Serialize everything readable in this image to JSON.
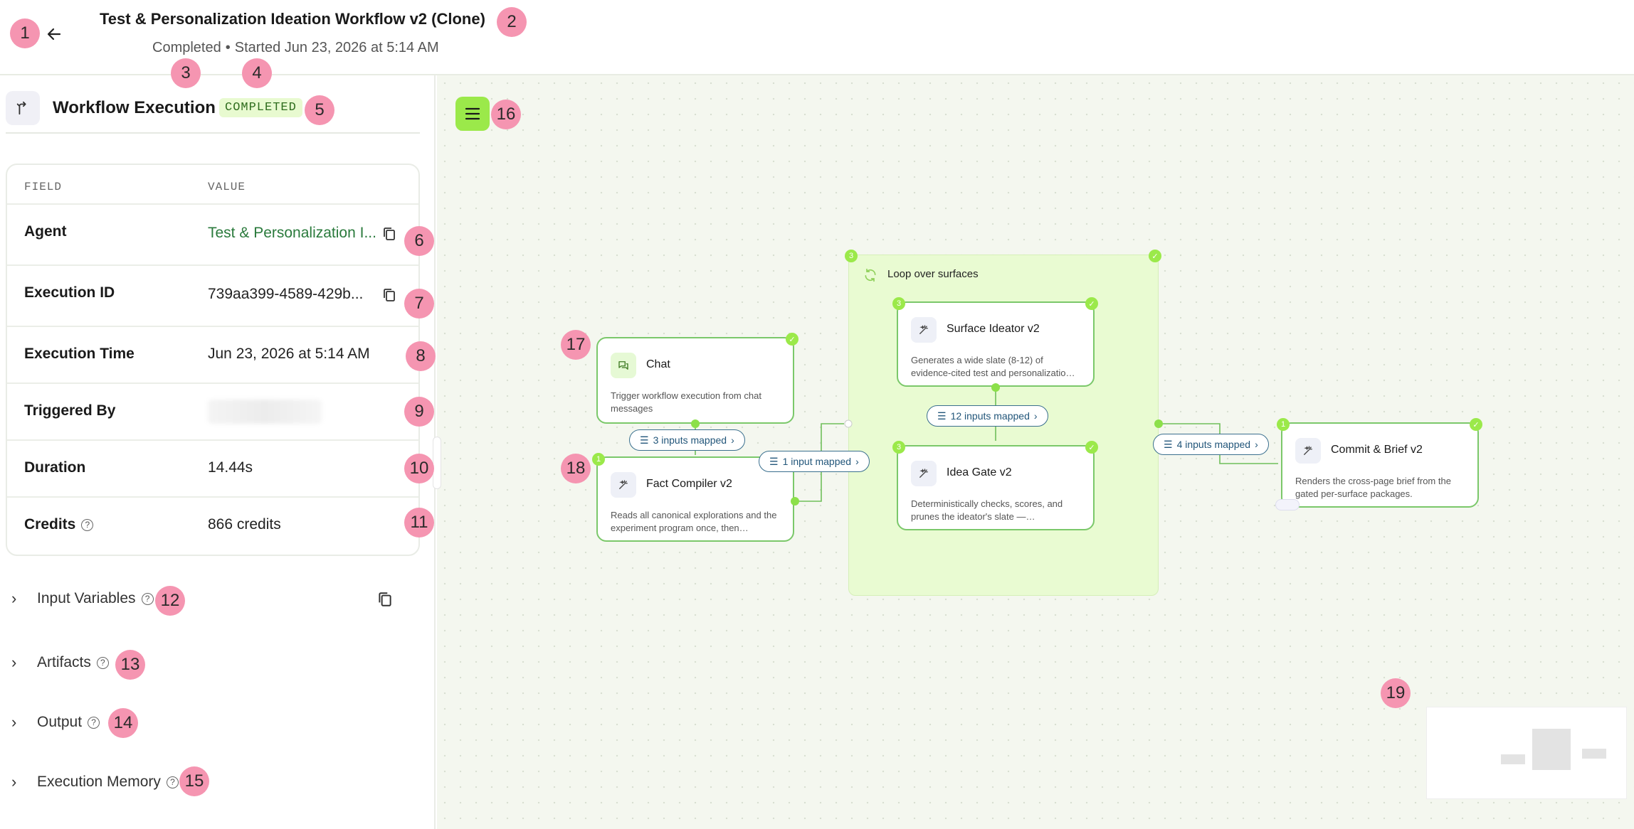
{
  "header": {
    "title": "Test & Personalization Ideation Workflow v2 (Clone)",
    "status": "Completed",
    "separator": "•",
    "started": "Started Jun 23, 2026 at 5:14 AM"
  },
  "panel": {
    "title": "Workflow Execution",
    "status_badge": "COMPLETED",
    "table": {
      "col_field": "FIELD",
      "col_value": "VALUE",
      "rows": {
        "agent": {
          "field": "Agent",
          "value": "Test & Personalization I..."
        },
        "execution_id": {
          "field": "Execution ID",
          "value": "739aa399-4589-429b..."
        },
        "execution_time": {
          "field": "Execution Time",
          "value": "Jun 23, 2026 at 5:14 AM"
        },
        "triggered_by": {
          "field": "Triggered By",
          "value": ""
        },
        "duration": {
          "field": "Duration",
          "value": "14.44s"
        },
        "credits": {
          "field": "Credits",
          "value": "866 credits"
        }
      }
    },
    "sections": {
      "input_variables": "Input Variables",
      "artifacts": "Artifacts",
      "output": "Output",
      "execution_memory": "Execution Memory"
    }
  },
  "canvas": {
    "loop": {
      "title": "Loop over surfaces",
      "count": "3"
    },
    "nodes": {
      "chat": {
        "title": "Chat",
        "desc": "Trigger workflow execution from chat messages"
      },
      "fact_compiler": {
        "title": "Fact Compiler v2",
        "desc": "Reads all canonical explorations and the experiment program once, then…",
        "count": "1"
      },
      "surface_ideator": {
        "title": "Surface Ideator v2",
        "desc": "Generates a wide slate (8-12) of evidence-cited test and personalizatio…",
        "count": "3"
      },
      "idea_gate": {
        "title": "Idea Gate v2",
        "desc": "Deterministically checks, scores, and prunes the ideator's slate —…",
        "count": "3"
      },
      "commit_brief": {
        "title": "Commit & Brief v2",
        "desc": "Renders the cross-page brief from the gated per-surface packages.",
        "count": "1"
      }
    },
    "edges": {
      "chat_to_fact": "3 inputs mapped",
      "fact_to_loop": "1 input mapped",
      "surface_to_gate": "12 inputs mapped",
      "loop_to_commit": "4 inputs mapped"
    }
  },
  "annotations": [
    "1",
    "2",
    "3",
    "4",
    "5",
    "6",
    "7",
    "8",
    "9",
    "10",
    "11",
    "12",
    "13",
    "14",
    "15",
    "16",
    "17",
    "18",
    "19"
  ],
  "colors": {
    "accent": "#9be94a",
    "loop_bg": "#e9fbd2",
    "edge": "#6fbf5a",
    "link": "#2a7a3c",
    "badge": "#f595b1"
  }
}
